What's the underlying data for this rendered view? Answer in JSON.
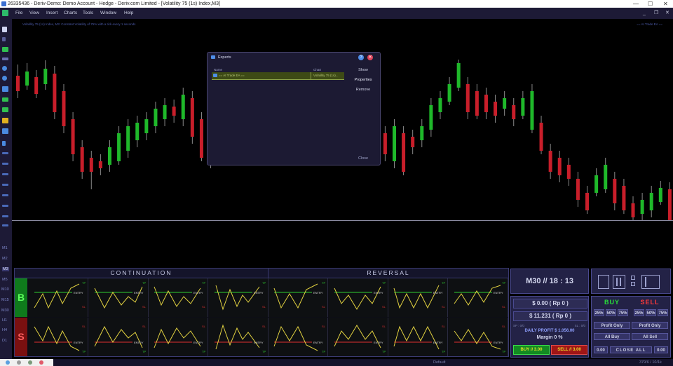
{
  "window": {
    "title": "26335436 - Deriv-Demo: Demo Account - Hedge - Deriv.com Limited - [Volatility 75 (1s) Index,M3]",
    "minimize": "—",
    "maximize": "☐",
    "close": "✕"
  },
  "menu": {
    "items": [
      "File",
      "View",
      "Insert",
      "Charts",
      "Tools",
      "Window",
      "Help"
    ],
    "child_minimize": "_",
    "child_restore": "❐",
    "child_close": "✕"
  },
  "left_toolbar": {
    "timeframes": [
      "M1",
      "M2",
      "M3",
      "M5",
      "M10",
      "M15",
      "M30",
      "H1",
      "H4",
      "D1"
    ],
    "active_timeframe": "M3"
  },
  "chart": {
    "info": "Volatility 75 (1s) Index, M3: Constant Volatility of 75% with a tick every 1 seconds",
    "ea_label": "== AI Trade EA ==",
    "colors": {
      "bull": "#1fb82a",
      "bear": "#c81e2a",
      "wick": "#8a8a8a"
    }
  },
  "experts_dialog": {
    "title": "Experts",
    "columns": {
      "name": "Name",
      "chart": "Chart"
    },
    "rows": [
      {
        "name": "== AI Trade EA ==",
        "chart": "Volatility 75 (1s)..."
      }
    ],
    "buttons": {
      "show": "Show",
      "properties": "Properties",
      "remove": "Remove"
    },
    "close_label": "Close",
    "help_button": "?",
    "close_button": "✕"
  },
  "patterns": {
    "continuation_label": "CONTINUATION",
    "reversal_label": "REVERSAL",
    "buy_label": "B",
    "sell_label": "S",
    "colors": {
      "buy": "#22bb33",
      "sell": "#d83030",
      "path": "#e0d040",
      "level_green": "#30d030",
      "level_red": "#e03030"
    },
    "tags": {
      "tp": "TP",
      "sl": "SL",
      "entry": "ENTRY"
    }
  },
  "trade_panel": {
    "clock": "M30 // 18 : 13",
    "balance": "$ 0.00 ( Rp 0 )",
    "equity": "$ 11.231 ( Rp 0 )",
    "sp_left": "SP : 0/0",
    "sp_right": "SL : 0/0",
    "daily_profit": "DAILY PROFIT $ 1.056.00",
    "margin": "Margin 0 %",
    "buy_button": "BUY // 3.00",
    "sell_button": "SELL // 3.00",
    "buy_header": "BUY",
    "sell_header": "SELL",
    "pct_buttons": [
      "25%",
      "50%",
      "75%"
    ],
    "profit_only": "Profit Only",
    "all_buy": "All Buy",
    "all_sell": "All Sell",
    "close_all": "CLOSE ALL",
    "buy_total": "0.00",
    "sell_total": "0.00"
  },
  "status_bar": {
    "profile": "Default",
    "connection": "379/6 / 10/1k"
  }
}
